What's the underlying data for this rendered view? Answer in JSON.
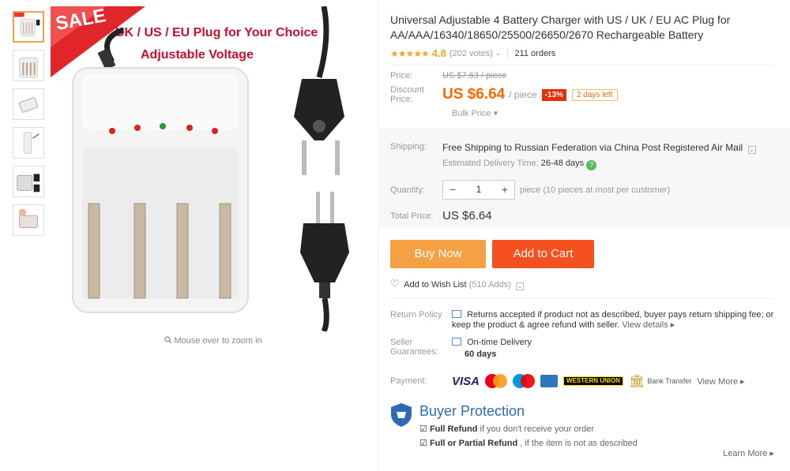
{
  "product": {
    "title": "Universal Adjustable 4 Battery Charger with US / UK / EU AC Plug for AA/AAA/16340/18650/25500/26650/2670 Rechargeable Battery",
    "stars": "★★★★★",
    "rating": "4.8",
    "votes": "(202 votes)",
    "orders": "211 orders"
  },
  "image": {
    "sale": "SALE",
    "headline": "UK / US / EU Plug for Your Choice",
    "subline": "Adjustable Voltage",
    "zoom_hint": "Mouse over to zoom in"
  },
  "price": {
    "price_label": "Price:",
    "old_price": "US $7.63 / piece",
    "discount_label": "Discount Price:",
    "discount_price": "US $6.64",
    "per_piece": "/ piece",
    "off": "-13%",
    "days_left": "2 days left",
    "bulk": "Bulk Price ▾"
  },
  "shipping": {
    "label": "Shipping:",
    "text": "Free Shipping to Russian Federation via China Post Registered Air Mail",
    "delivery_label": "Estimated Delivery Time:",
    "delivery_value": "26-48 days"
  },
  "quantity": {
    "label": "Quantity:",
    "minus": "−",
    "value": "1",
    "plus": "+",
    "note": "piece (10 pieces at most per customer)"
  },
  "total": {
    "label": "Total Price:",
    "value": "US $6.64"
  },
  "buttons": {
    "buy": "Buy Now",
    "cart": "Add to Cart"
  },
  "wishlist": {
    "label": "Add to Wish List",
    "count": "(510 Adds)"
  },
  "return_policy": {
    "label": "Return Policy",
    "text": "Returns accepted if product not as described, buyer pays return shipping fee; or keep the product & agree refund with seller.",
    "link": "View details ▸"
  },
  "guarantee": {
    "label": "Seller Guarantees:",
    "line1": "On-time Delivery",
    "line2": "60 days"
  },
  "payment": {
    "label": "Payment:",
    "visa": "VISA",
    "wu": "WESTERN UNION",
    "bank": "Bank Transfer",
    "more": "View More ▸"
  },
  "protection": {
    "title": "Buyer Protection",
    "full_refund": "Full Refund",
    "full_refund_sub": "if you don't receive your order",
    "partial": "Full or Partial Refund",
    "partial_sub": ", if the item is not as described",
    "learn": "Learn More ▸"
  },
  "colors": {
    "accent_orange": "#f60",
    "buy_button": "#f5a043",
    "cart_button": "#f4511e",
    "protection_blue": "#2d6cb5"
  }
}
